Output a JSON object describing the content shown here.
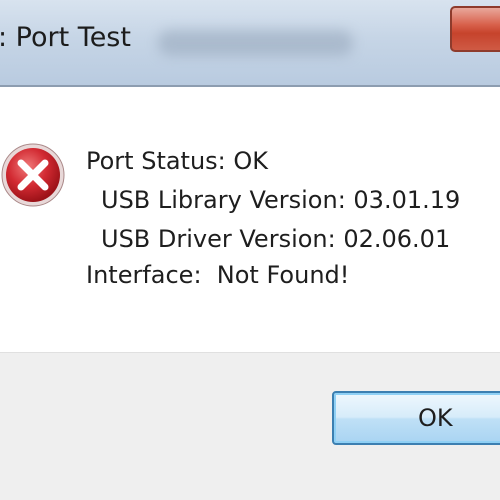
{
  "window": {
    "title": ": Port Test"
  },
  "message": {
    "icon": "error-icon",
    "lines": [
      "Port Status: OK",
      "USB Library Version: 03.01.19",
      "USB Driver Version: 02.06.01",
      "Interface:  Not Found!"
    ]
  },
  "buttons": {
    "ok_label": "OK"
  },
  "colors": {
    "error_red": "#c8202a",
    "close_button_red": "#c6432c",
    "button_border_blue": "#3c7fb1"
  }
}
